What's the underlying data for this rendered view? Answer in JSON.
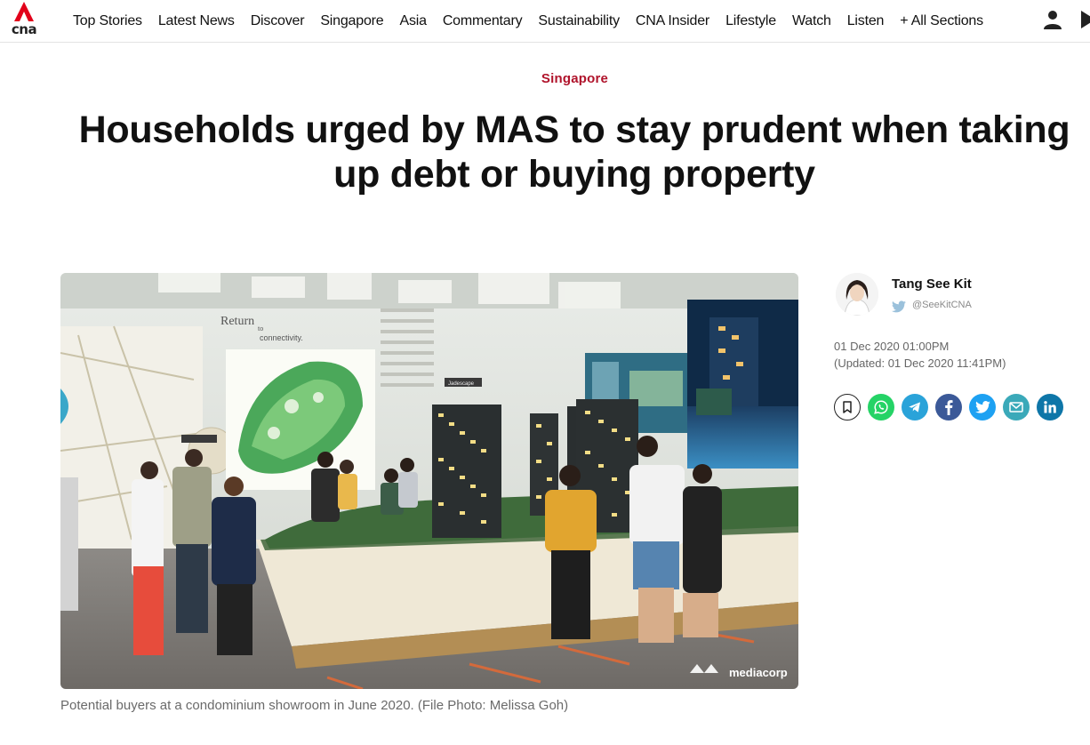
{
  "logo": {
    "text": "cna"
  },
  "nav": {
    "items": [
      "Top Stories",
      "Latest News",
      "Discover",
      "Singapore",
      "Asia",
      "Commentary",
      "Sustainability",
      "CNA Insider",
      "Lifestyle",
      "Watch",
      "Listen"
    ],
    "all_sections": "+ All Sections"
  },
  "article": {
    "category": "Singapore",
    "headline": "Households urged by MAS to stay prudent when taking up debt or buying property",
    "image": {
      "caption": "Potential buyers at a condominium showroom in June 2020. (File Photo: Melissa Goh)",
      "watermark": "mediacorp",
      "wall_text_1": "Return",
      "wall_text_2": "to",
      "wall_text_3": "connectivity.",
      "sign_text": "Jadescape"
    }
  },
  "author": {
    "name": "Tang See Kit",
    "handle": "@SeeKitCNA"
  },
  "dates": {
    "published": "01 Dec 2020 01:00PM",
    "updated": "(Updated: 01 Dec 2020 11:41PM)"
  },
  "share": {
    "icons": [
      "bookmark-icon",
      "whatsapp-icon",
      "telegram-icon",
      "facebook-icon",
      "twitter-icon",
      "email-icon",
      "linkedin-icon"
    ]
  },
  "colors": {
    "brand_red": "#e2001a",
    "category_red": "#b0132b",
    "whatsapp": "#25d366",
    "telegram": "#2aa3d9",
    "facebook": "#3b5998",
    "twitter": "#1da1f2",
    "email": "#3aa9b9",
    "linkedin": "#0e76a8"
  }
}
